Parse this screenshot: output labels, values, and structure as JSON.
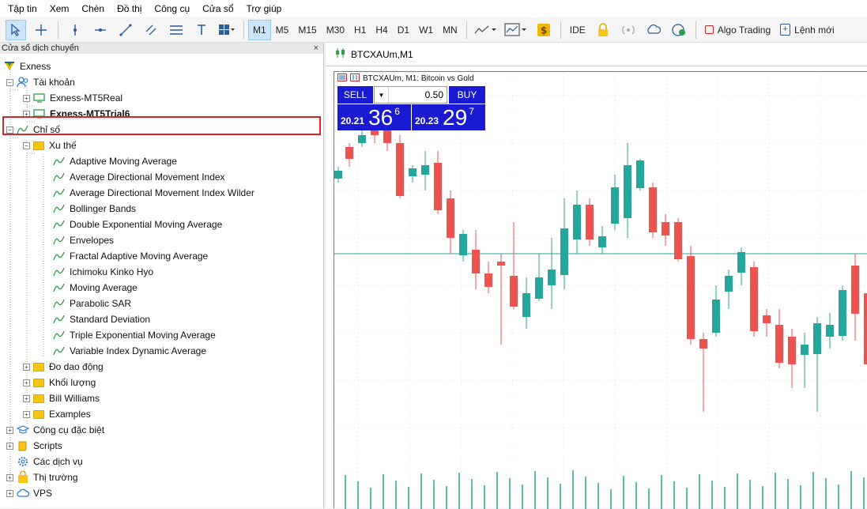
{
  "menu": [
    "Tập tin",
    "Xem",
    "Chèn",
    "Đồ thị",
    "Công cụ",
    "Cửa sổ",
    "Trợ giúp"
  ],
  "toolbar": {
    "timeframes": [
      "M1",
      "M5",
      "M15",
      "M30",
      "H1",
      "H4",
      "D1",
      "W1",
      "MN"
    ],
    "active_timeframe": "M1",
    "ide_label": "IDE",
    "algo_label": "Algo Trading",
    "new_order_label": "Lệnh mới"
  },
  "navigator": {
    "title": "Cửa sổ dịch chuyển",
    "close": "×",
    "root": "Exness",
    "accounts_label": "Tài khoản",
    "accounts": [
      "Exness-MT5Real",
      "Exness-MT5Trial6"
    ],
    "indicators_label": "Chỉ số",
    "trend_label": "Xu thế",
    "trend_items": [
      "Adaptive Moving Average",
      "Average Directional Movement Index",
      "Average Directional Movement Index Wilder",
      "Bollinger Bands",
      "Double Exponential Moving Average",
      "Envelopes",
      "Fractal Adaptive Moving Average",
      "Ichimoku Kinko Hyo",
      "Moving Average",
      "Parabolic SAR",
      "Standard Deviation",
      "Triple Exponential Moving Average",
      "Variable Index Dynamic Average"
    ],
    "other_folders": [
      "Đo dao động",
      "Khối lượng",
      "Bill Williams",
      "Examples"
    ],
    "bottom_items": [
      "Công cụ đặc biệt",
      "Scripts",
      "Các dịch vụ",
      "Thị trường",
      "VPS"
    ]
  },
  "chart": {
    "tab_label": "BTCXAUm,M1",
    "title_text": "BTCXAUm, M1:  Bitcoin vs Gold",
    "sell_label": "SELL",
    "buy_label": "BUY",
    "lot": "0.50",
    "sell_small": "20.21",
    "sell_big": "36",
    "sell_sup": "6",
    "buy_small": "20.23",
    "buy_big": "29",
    "buy_sup": "7",
    "colors": {
      "up": "#26a69a",
      "down": "#ef5350",
      "trade": "#1a1ad2"
    }
  }
}
